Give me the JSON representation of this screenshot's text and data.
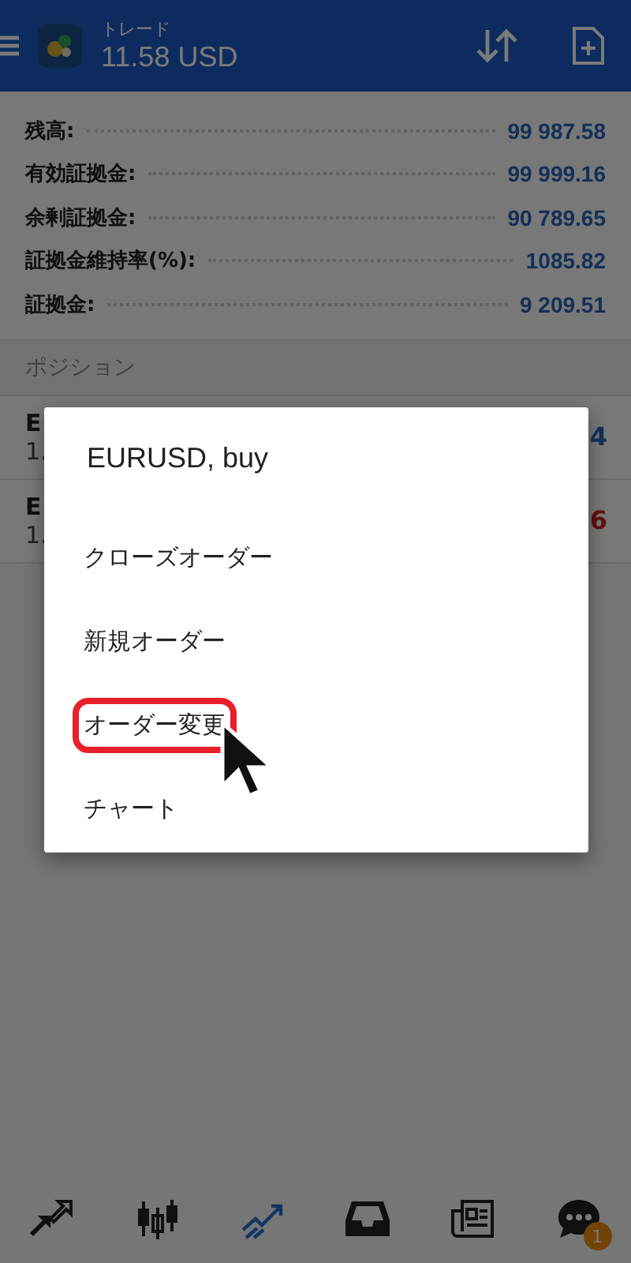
{
  "header": {
    "title": "トレード",
    "balance": "11.58 USD"
  },
  "account": [
    {
      "label": "残高:",
      "value": "99 987.58"
    },
    {
      "label": "有効証拠金:",
      "value": "99 999.16"
    },
    {
      "label": "余剰証拠金:",
      "value": "90 789.65"
    },
    {
      "label": "証拠金維持率(%):",
      "value": "1085.82"
    },
    {
      "label": "証拠金:",
      "value": "9 209.51"
    }
  ],
  "section": "ポジション",
  "positions": [
    {
      "symbol": "E",
      "price": "1.",
      "profit": "4",
      "loss": false
    },
    {
      "symbol": "E",
      "price": "1.",
      "profit": "6",
      "loss": true
    }
  ],
  "dialog": {
    "title": "EURUSD, buy",
    "items": [
      {
        "label": "クローズオーダー",
        "annotated": false
      },
      {
        "label": "新規オーダー",
        "annotated": false
      },
      {
        "label": "オーダー変更",
        "annotated": true
      },
      {
        "label": "チャート",
        "annotated": false
      }
    ]
  },
  "nav": [
    {
      "selected": false
    },
    {
      "selected": false
    },
    {
      "selected": true
    },
    {
      "selected": false
    },
    {
      "selected": false
    },
    {
      "selected": false,
      "badge": "1"
    }
  ]
}
